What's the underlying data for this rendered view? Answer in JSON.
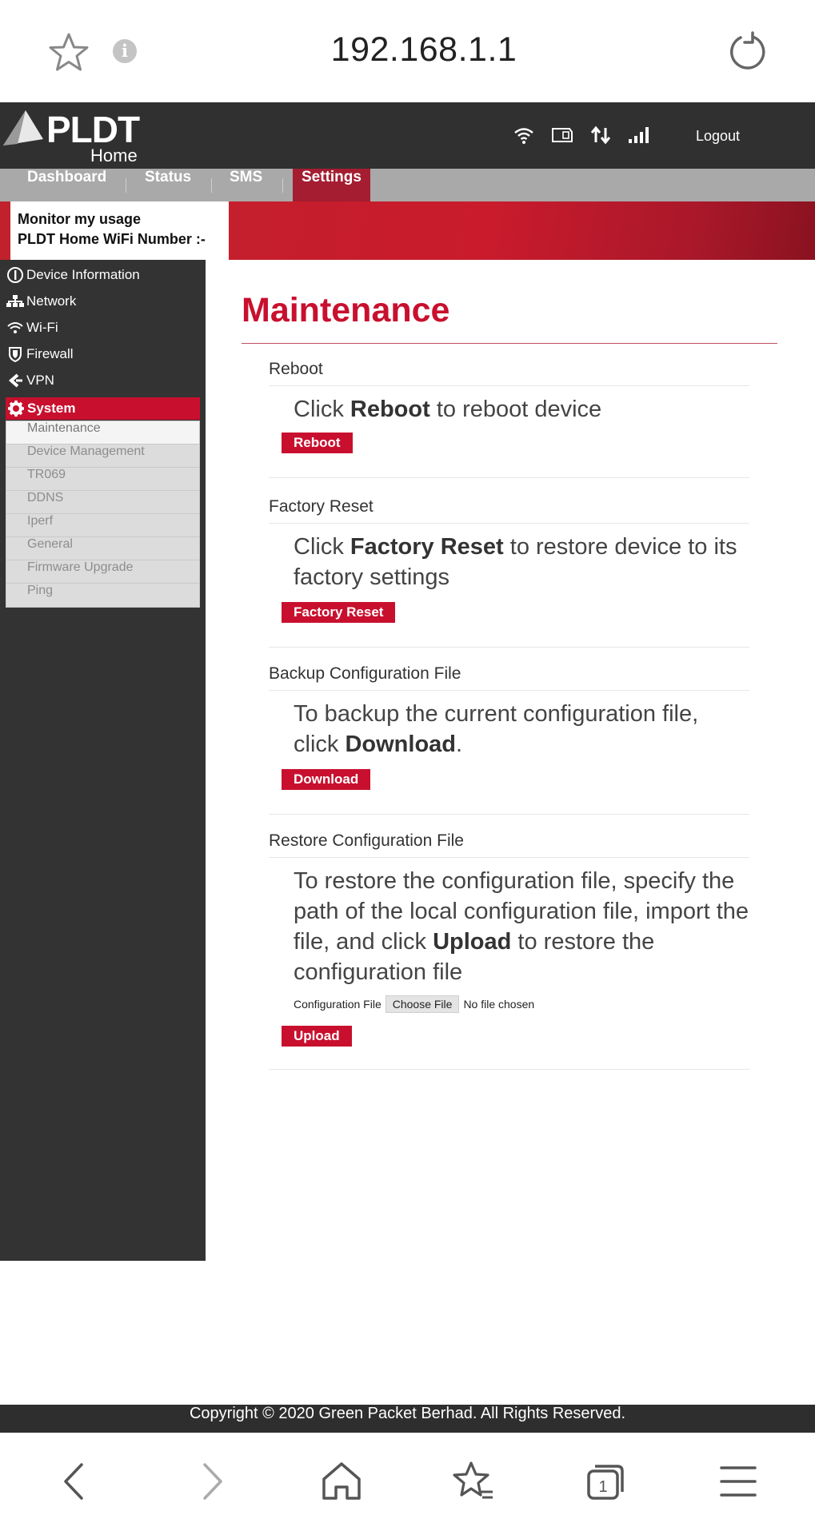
{
  "browser": {
    "url": "192.168.1.1",
    "icons": [
      "star-icon",
      "info-icon",
      "reload-icon"
    ],
    "info_glyph": "i",
    "bottom_nav": [
      "back-icon",
      "forward-icon",
      "home-icon",
      "bookmarks-icon",
      "tabs-icon",
      "menu-icon"
    ],
    "tab_count": "1"
  },
  "header": {
    "brand": "PLDT",
    "brand_sub": "Home",
    "status_icons": [
      "wifi-icon",
      "sim-card-icon",
      "data-transfer-icon",
      "signal-icon"
    ],
    "logout_label": "Logout"
  },
  "nav": {
    "tabs": [
      {
        "label": "Dashboard"
      },
      {
        "label": "Status"
      },
      {
        "label": "SMS"
      },
      {
        "label": "Settings"
      }
    ],
    "active_tab": "Settings"
  },
  "banner": {
    "line1": "Monitor my usage",
    "line2": "PLDT Home WiFi Number :-"
  },
  "sidebar": {
    "items": [
      {
        "label": "Device Information",
        "icon": "info-circle-icon"
      },
      {
        "label": "Network",
        "icon": "network-icon"
      },
      {
        "label": "Wi-Fi",
        "icon": "wifi-icon"
      },
      {
        "label": "Firewall",
        "icon": "shield-icon"
      },
      {
        "label": "VPN",
        "icon": "vpn-icon"
      }
    ],
    "system": {
      "label": "System",
      "icon": "gear-icon"
    },
    "submenu": [
      {
        "label": "Maintenance"
      },
      {
        "label": "Device Management"
      },
      {
        "label": "TR069"
      },
      {
        "label": "DDNS"
      },
      {
        "label": "Iperf"
      },
      {
        "label": "General"
      },
      {
        "label": "Firmware Upgrade"
      },
      {
        "label": "Ping"
      }
    ],
    "selected_submenu": "Maintenance"
  },
  "main": {
    "title": "Maintenance",
    "sections": {
      "reboot": {
        "title": "Reboot",
        "desc_pre": "Click ",
        "desc_bold": "Reboot",
        "desc_post": " to reboot device",
        "button": "Reboot"
      },
      "factory_reset": {
        "title": "Factory Reset",
        "desc_pre": "Click ",
        "desc_bold": "Factory Reset",
        "desc_post": " to restore device to its factory settings",
        "button": "Factory Reset"
      },
      "backup": {
        "title": "Backup Configuration File",
        "desc_pre": "To backup the current configuration file, click ",
        "desc_bold": "Download",
        "desc_post": ".",
        "button": "Download"
      },
      "restore": {
        "title": "Restore Configuration File",
        "desc_pre": "To restore the configuration file, specify the path of the local configuration file, import the file, and click ",
        "desc_bold": "Upload",
        "desc_post": " to restore the configuration file",
        "file_label": "Configuration File",
        "choose_label": "Choose File",
        "no_file": "No file chosen",
        "button": "Upload"
      }
    }
  },
  "footer": {
    "copyright": "Copyright © 2020 Green Packet Berhad. All Rights Reserved."
  },
  "colors": {
    "accent": "#c8102e",
    "header_bg": "#303030",
    "nav_bg": "#a9a9a9",
    "sidebar_bg": "#333333"
  }
}
